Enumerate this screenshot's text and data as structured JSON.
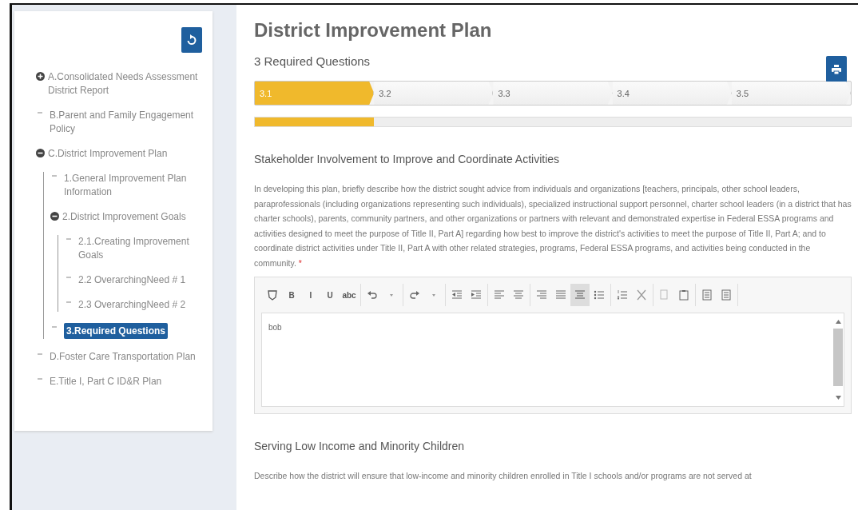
{
  "sidebar": {
    "items": [
      {
        "kind": "branch",
        "label": "A.Consolidated Needs Assessment District Report",
        "expanded": false,
        "selected": false
      },
      {
        "kind": "leaf",
        "label": "B.Parent and Family Engagement Policy",
        "selected": false
      },
      {
        "kind": "branch",
        "label": "C.District Improvement Plan",
        "expanded": true,
        "selected": false,
        "children": [
          {
            "kind": "leaf",
            "label": "1.General Improvement Plan Information",
            "selected": false
          },
          {
            "kind": "branch",
            "label": "2.District Improvement Goals",
            "expanded": true,
            "selected": false,
            "children": [
              {
                "kind": "leaf",
                "label": "2.1.Creating Improvement Goals",
                "selected": false
              },
              {
                "kind": "leaf",
                "label": "2.2 OverarchingNeed # 1",
                "selected": false
              },
              {
                "kind": "leaf",
                "label": "2.3 OverarchingNeed # 2",
                "selected": false
              }
            ]
          },
          {
            "kind": "leaf",
            "label": "3.Required Questions",
            "selected": true
          }
        ]
      },
      {
        "kind": "leaf",
        "label": "D.Foster Care Transportation Plan",
        "selected": false
      },
      {
        "kind": "leaf",
        "label": "E.Title I, Part C ID&R Plan",
        "selected": false
      }
    ]
  },
  "main": {
    "title": "District Improvement Plan",
    "subtitle": "3 Required Questions",
    "steps": [
      {
        "label": "3.1",
        "selected": true
      },
      {
        "label": "3.2",
        "selected": false
      },
      {
        "label": "3.3",
        "selected": false
      },
      {
        "label": "3.4",
        "selected": false
      },
      {
        "label": "3.5",
        "selected": false
      }
    ],
    "progress": {
      "level": 0.2
    },
    "questions": [
      {
        "heading": "Stakeholder Involvement to Improve and Coordinate Activities",
        "text": "In developing this plan, briefly describe how the district sought advice from individuals and organizations [teachers, principals, other school leaders, paraprofessionals (including organizations representing such individuals), specialized instructional support personnel, charter school leaders (in a district that has charter schools), parents, community partners, and other organizations or partners with relevant and demonstrated expertise in Federal ESSA programs and activities designed to meet the purpose of Title II, Part A] regarding how best to improve the district's activities to meet the purpose of Title II, Part A; and to coordinate district activities under Title II, Part A with other related strategies, programs, Federal ESSA programs, and activities being conducted in the community.",
        "required_mark": "*",
        "editor": {
          "value": "bob",
          "toolbar": [
            [
              {
                "kind": "source",
                "active": false
              },
              {
                "kind": "text",
                "label": "B",
                "active": false
              },
              {
                "kind": "text",
                "label": "I",
                "active": false
              },
              {
                "kind": "text",
                "label": "U",
                "active": false
              },
              {
                "kind": "text",
                "label": "abc",
                "active": false
              }
            ],
            [
              {
                "kind": "undo",
                "active": false
              },
              {
                "kind": "caret",
                "active": false
              }
            ],
            [
              {
                "kind": "redo",
                "active": false
              },
              {
                "kind": "caret",
                "active": false
              }
            ],
            [
              {
                "kind": "outdent",
                "active": false
              },
              {
                "kind": "indent",
                "active": false
              }
            ],
            [
              {
                "kind": "align-left",
                "active": false
              },
              {
                "kind": "align-center",
                "active": false
              }
            ],
            [
              {
                "kind": "align-right",
                "active": false
              },
              {
                "kind": "justify",
                "active": false
              },
              {
                "kind": "block",
                "active": true
              },
              {
                "kind": "bullets",
                "active": false
              }
            ],
            [
              {
                "kind": "numbers",
                "active": false
              },
              {
                "kind": "cut",
                "active": false
              }
            ],
            [
              {
                "kind": "copy",
                "active": false
              },
              {
                "kind": "paste",
                "active": false
              }
            ],
            [
              {
                "kind": "page",
                "active": false
              },
              {
                "kind": "page",
                "active": false
              }
            ]
          ]
        }
      },
      {
        "heading": "Serving Low Income and Minority Children",
        "text": "Describe how the district will ensure that low-income and minority children enrolled in Title I schools and/or programs are not served at"
      }
    ]
  }
}
